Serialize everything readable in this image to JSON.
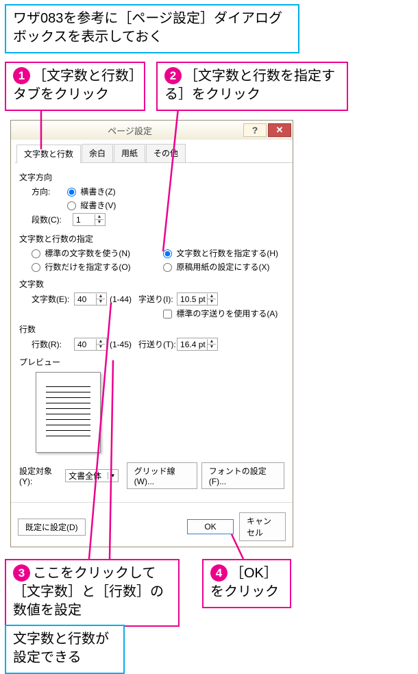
{
  "colors": {
    "magenta": "#ec008c",
    "cyan": "#00aeef",
    "close_red": "#c8504f"
  },
  "callouts": {
    "intro": "ワザ083を参考に［ページ設定］ダイアログボックスを表示しておく",
    "c1_num": "1",
    "c1": "［文字数と行数］タブをクリック",
    "c2_num": "2",
    "c2": "［文字数と行数を指定する］をクリック",
    "c3_num": "3",
    "c3": "ここをクリックして［文字数］と［行数］の数値を設定",
    "c4_num": "4",
    "c4": "［OK］をクリック",
    "result": "文字数と行数が設定できる"
  },
  "dialog": {
    "title": "ページ設定",
    "help_glyph": "?",
    "close_glyph": "✕",
    "tabs": [
      "文字数と行数",
      "余白",
      "用紙",
      "その他"
    ],
    "direction": {
      "section": "文字方向",
      "label": "方向:",
      "horizontal": "横書き(Z)",
      "vertical": "縦書き(V)",
      "columns_label": "段数(C):",
      "columns_value": "1"
    },
    "spec": {
      "section": "文字数と行数の指定",
      "opt_default": "標準の文字数を使う(N)",
      "opt_lines_only": "行数だけを指定する(O)",
      "opt_chars_lines": "文字数と行数を指定する(H)",
      "opt_grid": "原稿用紙の設定にする(X)"
    },
    "chars": {
      "section": "文字数",
      "label": "文字数(E):",
      "value": "40",
      "range": "(1-44)",
      "pitch_label": "字送り(I):",
      "pitch_value": "10.5 pt",
      "std_pitch": "標準の字送りを使用する(A)"
    },
    "lines": {
      "section": "行数",
      "label": "行数(R):",
      "value": "40",
      "range": "(1-45)",
      "pitch_label": "行送り(T):",
      "pitch_value": "16.4 pt"
    },
    "preview_label": "プレビュー",
    "apply_to_label": "設定対象(Y):",
    "apply_to_value": "文書全体",
    "grid_button": "グリッド線(W)...",
    "font_button": "フォントの設定(F)...",
    "set_default": "既定に設定(D)",
    "ok": "OK",
    "cancel": "キャンセル"
  }
}
